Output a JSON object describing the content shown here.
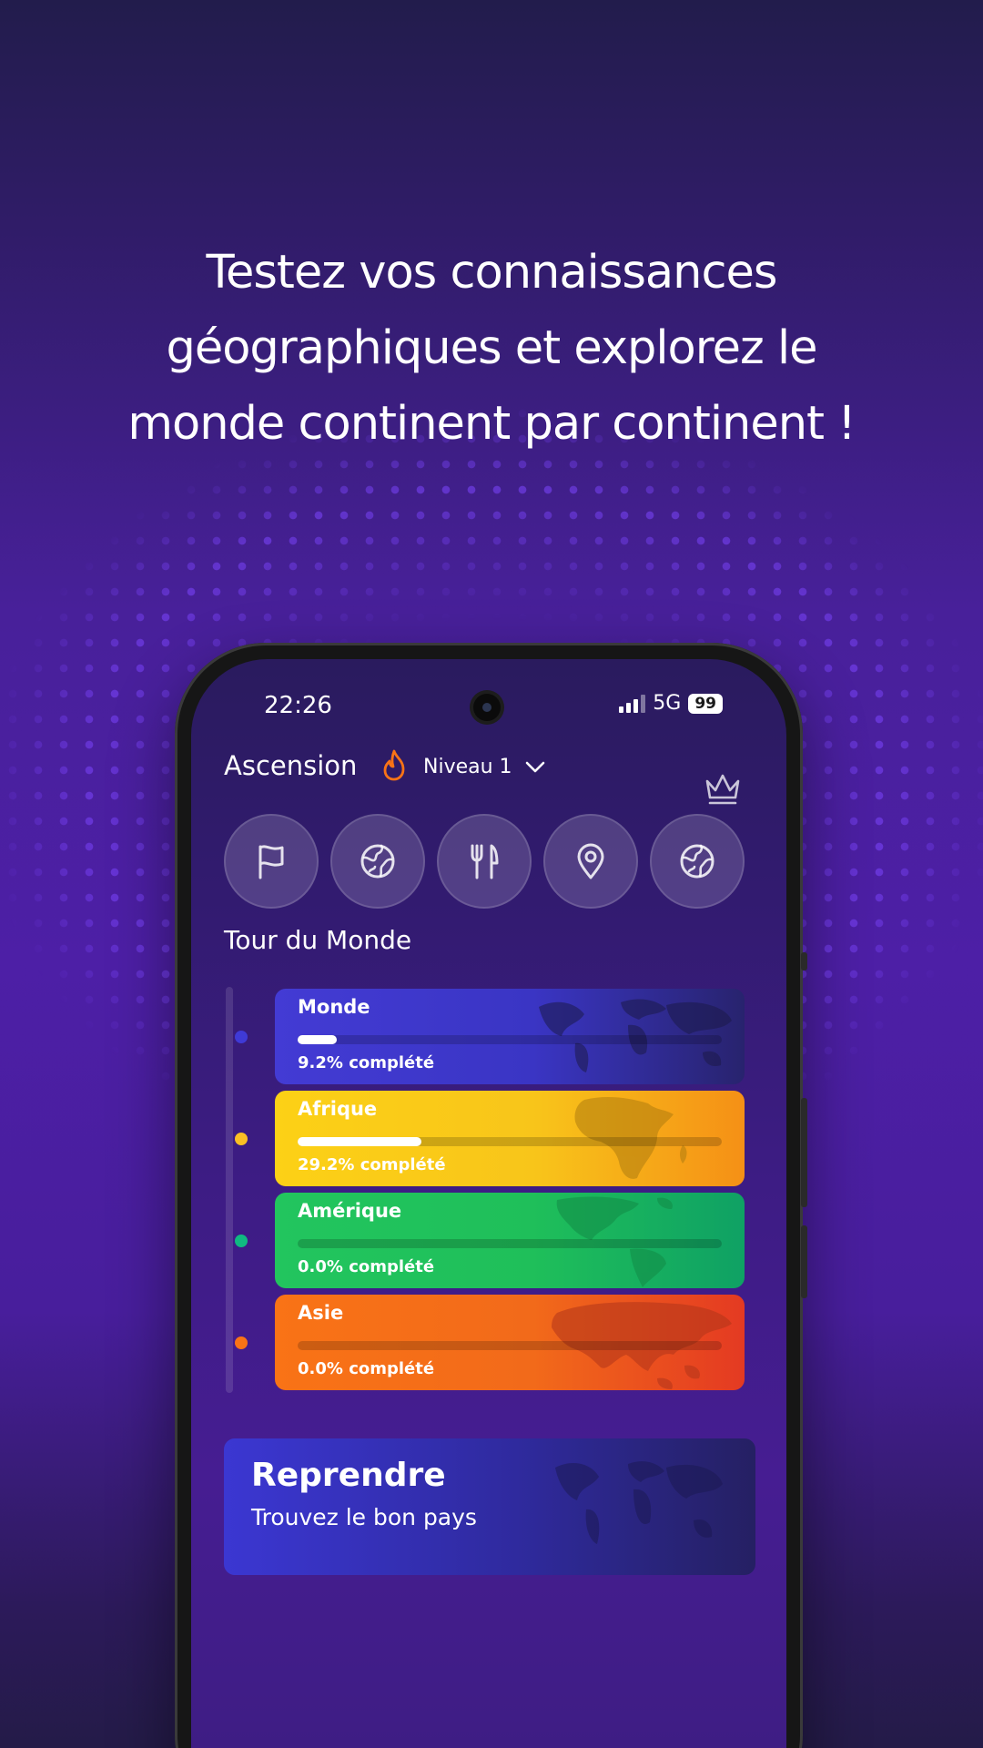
{
  "headline": {
    "line1": "Testez vos connaissances",
    "line2": "géographiques et explorez le",
    "line3": "monde continent par continent !"
  },
  "status_bar": {
    "time": "22:26",
    "network": "5G",
    "battery": "99"
  },
  "app": {
    "title": "Ascension",
    "level_label": "Niveau 1",
    "categories": [
      {
        "icon": "flag-icon"
      },
      {
        "icon": "globe-icon"
      },
      {
        "icon": "fork-knife-icon"
      },
      {
        "icon": "map-pin-icon"
      },
      {
        "icon": "globe-icon"
      }
    ],
    "section_title": "Tour du Monde",
    "continents": [
      {
        "name": "Monde",
        "progress_label": "9.2% complété",
        "progress": 9.2,
        "color": "#3f3ad6",
        "dot_color": "#3f3ad6"
      },
      {
        "name": "Afrique",
        "progress_label": "29.2% complété",
        "progress": 29.2,
        "color": "#facc15",
        "dot_color": "#fbbf24"
      },
      {
        "name": "Amérique",
        "progress_label": "0.0% complété",
        "progress": 0.0,
        "color": "#22c55e",
        "dot_color": "#10b981"
      },
      {
        "name": "Asie",
        "progress_label": "0.0% complété",
        "progress": 0.0,
        "color": "#f97316",
        "dot_color": "#f97316"
      }
    ],
    "resume": {
      "title": "Reprendre",
      "subtitle": "Trouvez le bon pays"
    }
  },
  "colors": {
    "background": "#4d1fa6",
    "flame": "#f97316",
    "accent": "#3f3ad6"
  }
}
